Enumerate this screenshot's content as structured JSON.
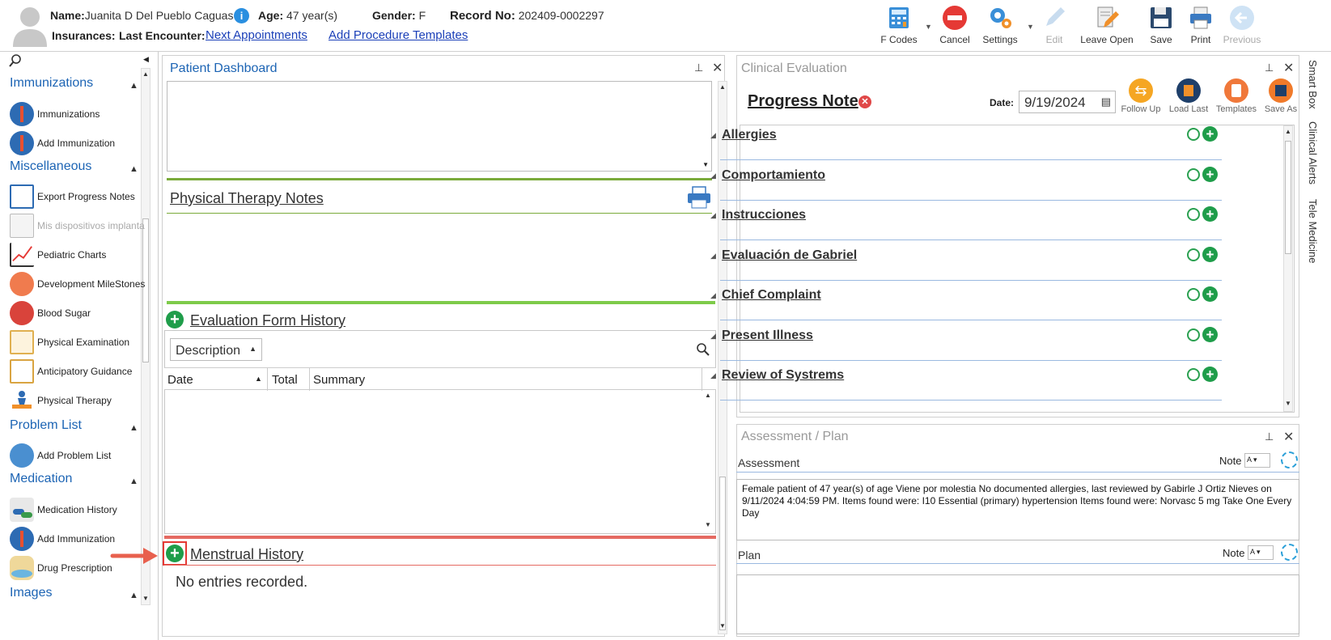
{
  "header": {
    "name_label": "Name:",
    "name_value": "Juanita D Del Pueblo Caguas",
    "age_label": "Age:",
    "age_value": "47 year(s)",
    "gender_label": "Gender:",
    "gender_value": "F",
    "record_label": "Record No:",
    "record_value": "202409-0002297",
    "insurances_label": "Insurances:",
    "last_encounter_label": "Last Encounter:",
    "next_appointments": "Next Appointments",
    "add_procedure_templates": "Add Procedure Templates"
  },
  "toolbar": {
    "fcodes": "F Codes",
    "cancel": "Cancel",
    "settings": "Settings",
    "edit": "Edit",
    "leave_open": "Leave Open",
    "save": "Save",
    "print": "Print",
    "previous": "Previous"
  },
  "sidebar": {
    "sections": {
      "immunizations": "Immunizations",
      "miscellaneous": "Miscellaneous",
      "problem_list": "Problem List",
      "medication": "Medication",
      "images": "Images"
    },
    "items": {
      "immunizations": "Immunizations",
      "add_immunization": "Add Immunization",
      "export_progress_notes": "Export Progress Notes",
      "mis_dispositivos": "Mis dispositivos implanta",
      "pediatric_charts": "Pediatric Charts",
      "development_milestones": "Development MileStones",
      "blood_sugar": "Blood Sugar",
      "physical_examination": "Physical Examination",
      "anticipatory_guidance": "Anticipatory Guidance",
      "physical_therapy": "Physical Therapy",
      "add_problem_list": "Add Problem List",
      "medication_history": "Medication History",
      "add_immunization_2": "Add Immunization",
      "drug_prescription": "Drug Prescription"
    }
  },
  "dashboard": {
    "title": "Patient Dashboard",
    "pt_notes": "Physical Therapy Notes",
    "eval_history": "Evaluation Form History",
    "description_dropdown": "Description",
    "col_date": "Date",
    "col_total": "Total",
    "col_summary": "Summary",
    "menstrual_history": "Menstrual History",
    "no_entries": "No entries recorded."
  },
  "clinical": {
    "title": "Clinical Evaluation",
    "progress_note": "Progress Note",
    "date_label": "Date:",
    "date_value": "9/19/2024",
    "follow_up": "Follow Up",
    "load_last": "Load Last",
    "templates": "Templates",
    "save_as": "Save As",
    "sections": [
      "Allergies",
      "Comportamiento",
      "Instrucciones",
      "Evaluación de Gabriel",
      "Chief Complaint",
      "Present Illness",
      "Review of Systrems"
    ]
  },
  "assessment": {
    "title": "Assessment / Plan",
    "assessment_label": "Assessment",
    "note_label": "Note",
    "assessment_text": "Female patient of 47 year(s) of age Viene por molestia     No documented allergies, last reviewed by Gabirle J Ortiz Nieves on 9/11/2024 4:04:59 PM.     Items found were:  I10 Essential (primary) hypertension  Items found were:  Norvasc 5 mg Take One Every Day",
    "plan_label": "Plan",
    "plan_note_label": "Note"
  },
  "right_tabs": {
    "smart_box": "Smart Box",
    "clinical_alerts": "Clinical Alerts",
    "tele_medicine": "Tele Medicine"
  },
  "colors": {
    "accent_blue": "#1c64b4",
    "green": "#1f9d4a",
    "red_highlight": "#e05050",
    "orange": "#f0902a"
  }
}
